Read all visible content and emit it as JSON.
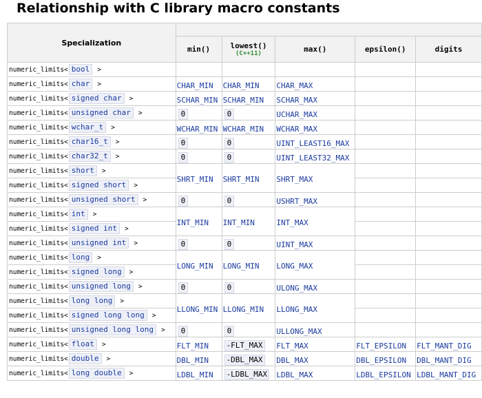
{
  "title": "Relationship with C library macro constants",
  "columns": {
    "specialization": "Specialization",
    "min": "min()",
    "lowest": "lowest()",
    "lowest_since": "(C++11)",
    "max": "max()",
    "epsilon": "epsilon()",
    "digits": "digits"
  },
  "prefix": "numeric_limits<",
  "suffix": ">",
  "rows": [
    {
      "type": "bool",
      "min": "",
      "lowest": "",
      "max": "",
      "epsilon": "",
      "digits": ""
    },
    {
      "type": "char",
      "min": "CHAR_MIN",
      "lowest": "CHAR_MIN",
      "max": "CHAR_MAX",
      "epsilon": "",
      "digits": ""
    },
    {
      "type": "signed char",
      "min": "SCHAR_MIN",
      "lowest": "SCHAR_MIN",
      "max": "SCHAR_MAX",
      "epsilon": "",
      "digits": ""
    },
    {
      "type": "unsigned char",
      "min": "0",
      "lowest": "0",
      "max": "UCHAR_MAX",
      "epsilon": "",
      "digits": ""
    },
    {
      "type": "wchar_t",
      "min": "WCHAR_MIN",
      "lowest": "WCHAR_MIN",
      "max": "WCHAR_MAX",
      "epsilon": "",
      "digits": ""
    },
    {
      "type": "char16_t",
      "min": "0",
      "lowest": "0",
      "max": "UINT_LEAST16_MAX",
      "epsilon": "",
      "digits": ""
    },
    {
      "type": "char32_t",
      "min": "0",
      "lowest": "0",
      "max": "UINT_LEAST32_MAX",
      "epsilon": "",
      "digits": ""
    },
    {
      "type": "short",
      "min": "SHRT_MIN",
      "lowest": "SHRT_MIN",
      "max": "SHRT_MAX",
      "epsilon": "",
      "digits": ""
    },
    {
      "type": "signed short"
    },
    {
      "type": "unsigned short",
      "min": "0",
      "lowest": "0",
      "max": "USHRT_MAX",
      "epsilon": "",
      "digits": ""
    },
    {
      "type": "int",
      "min": "INT_MIN",
      "lowest": "INT_MIN",
      "max": "INT_MAX",
      "epsilon": "",
      "digits": ""
    },
    {
      "type": "signed int"
    },
    {
      "type": "unsigned int",
      "min": "0",
      "lowest": "0",
      "max": "UINT_MAX",
      "epsilon": "",
      "digits": ""
    },
    {
      "type": "long",
      "min": "LONG_MIN",
      "lowest": "LONG_MIN",
      "max": "LONG_MAX",
      "epsilon": "",
      "digits": ""
    },
    {
      "type": "signed long"
    },
    {
      "type": "unsigned long",
      "min": "0",
      "lowest": "0",
      "max": "ULONG_MAX",
      "epsilon": "",
      "digits": ""
    },
    {
      "type": "long long",
      "min": "LLONG_MIN",
      "lowest": "LLONG_MIN",
      "max": "LLONG_MAX",
      "epsilon": "",
      "digits": ""
    },
    {
      "type": "signed long long"
    },
    {
      "type": "unsigned long long",
      "min": "0",
      "lowest": "0",
      "max": "ULLONG_MAX",
      "epsilon": "",
      "digits": ""
    },
    {
      "type": "float",
      "min": "FLT_MIN",
      "lowest": "-FLT_MAX",
      "max": "FLT_MAX",
      "epsilon": "FLT_EPSILON",
      "digits": "FLT_MANT_DIG"
    },
    {
      "type": "double",
      "min": "DBL_MIN",
      "lowest": "-DBL_MAX",
      "max": "DBL_MAX",
      "epsilon": "DBL_EPSILON",
      "digits": "DBL_MANT_DIG"
    },
    {
      "type": "long double",
      "min": "LDBL_MIN",
      "lowest": "-LDBL_MAX",
      "max": "LDBL_MAX",
      "epsilon": "LDBL_EPSILON",
      "digits": "LDBL_MANT_DIG"
    }
  ],
  "colors": {
    "keyword": "#1a3a9e",
    "since": "#2c8a2c",
    "header_bg": "#f2f2f2",
    "border": "#cccccc"
  }
}
